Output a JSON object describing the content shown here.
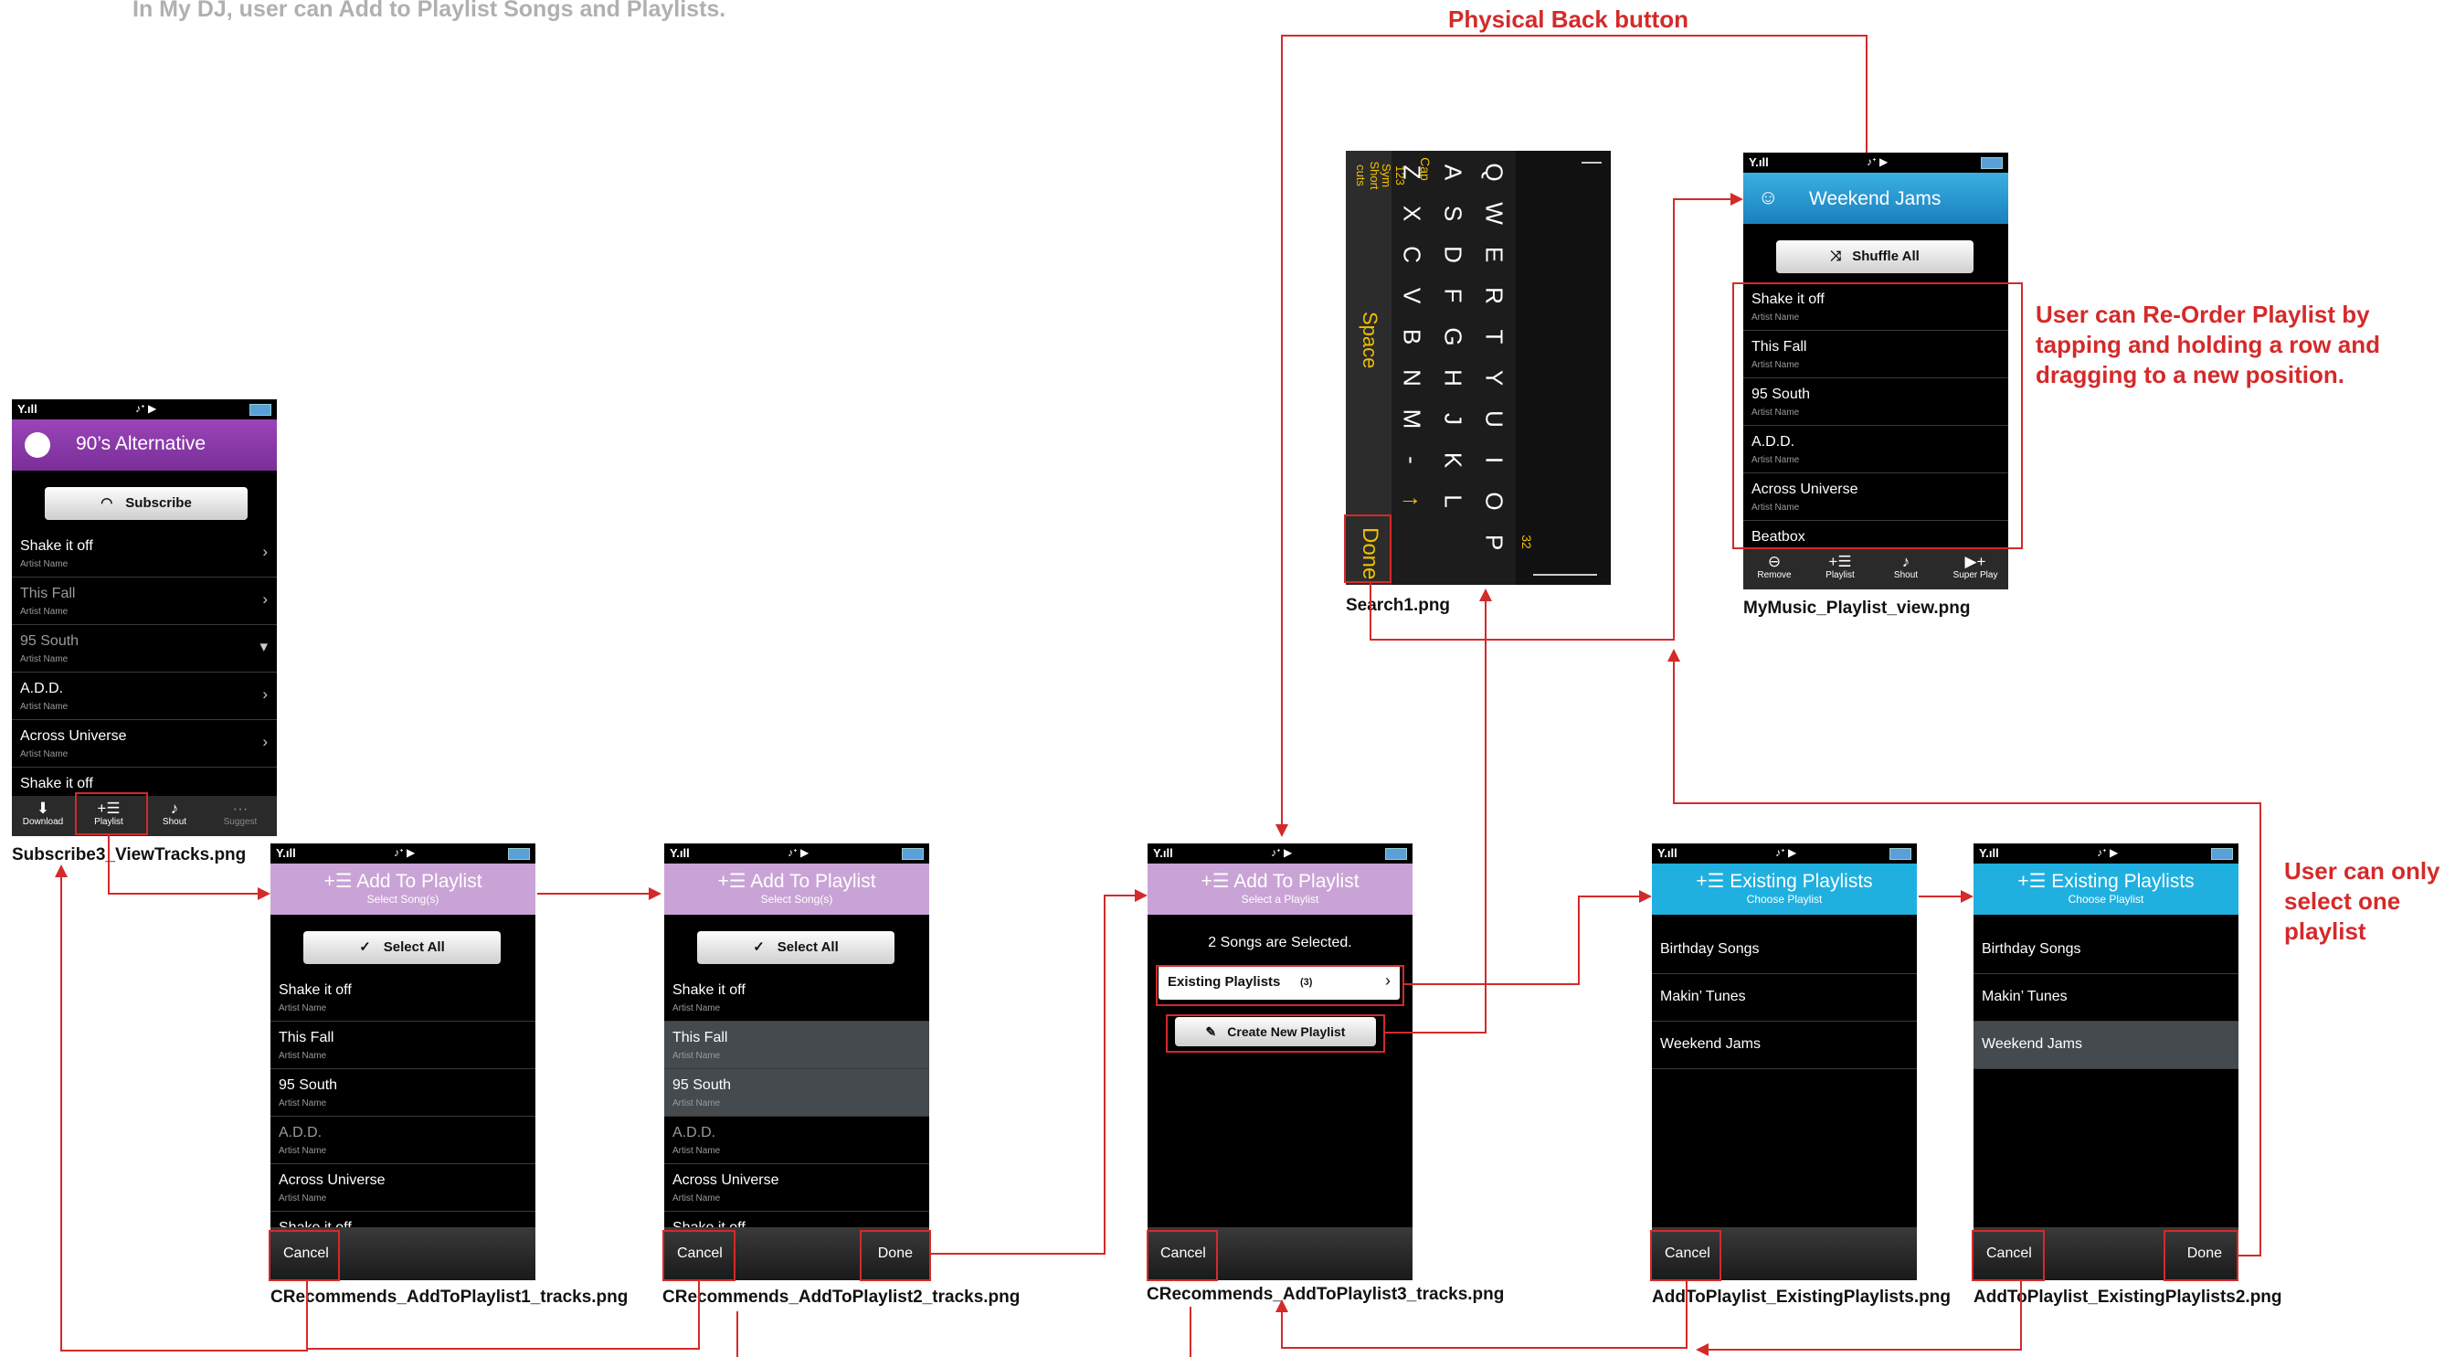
{
  "title": "In My DJ, user can Add to Playlist Songs and Playlists.",
  "notes": {
    "back": "Physical Back button",
    "reorder": [
      "User can Re-Order Playlist by",
      "tapping and holding a row and",
      "dragging to a new position."
    ],
    "only_one": [
      "User can only",
      "select one",
      "playlist"
    ]
  },
  "captions": {
    "s1": "Subscribe3_ViewTracks.png",
    "s2": "CRecommends_AddToPlaylist1_tracks.png",
    "s3": "CRecommends_AddToPlaylist2_tracks.png",
    "s4": "CRecommends_AddToPlaylist3_tracks.png",
    "s5": "AddToPlaylist_ExistingPlaylists.png",
    "s6": "AddToPlaylist_ExistingPlaylists2.png",
    "search": "Search1.png",
    "mymusic": "MyMusic_Playlist_view.png"
  },
  "colors": {
    "accent": "#d42a2a",
    "purple": "#8a3aa8",
    "lilac": "#c9a3d6",
    "cyan": "#1fb0e0",
    "blue": "#2a8fd0"
  },
  "artist": "Artist Name",
  "s1": {
    "header": "90’s Alternative",
    "button": "Subscribe",
    "tracks": [
      "Shake it off",
      "This Fall",
      "95 South",
      "A.D.D.",
      "Across Universe",
      "Shake it off"
    ],
    "tabs": [
      "Download",
      "Playlist",
      "Shout",
      "Suggest"
    ]
  },
  "add": {
    "title": "Add To Playlist",
    "sub_songs": "Select Song(s)",
    "sub_playlist": "Select a Playlist",
    "select_all": "Select All",
    "tracks": [
      "Shake it off",
      "This Fall",
      "95 South",
      "A.D.D.",
      "Across Universe",
      "Shake it off"
    ],
    "cancel": "Cancel",
    "done": "Done",
    "selected_msg": "2 Songs are Selected.",
    "existing": "Existing Playlists",
    "existing_count": "(3)",
    "create_new": "Create New Playlist"
  },
  "existing": {
    "title": "Existing Playlists",
    "sub": "Choose Playlist",
    "items": [
      "Birthday Songs",
      "Makin’ Tunes",
      "Weekend Jams"
    ]
  },
  "mymusic": {
    "header": "Weekend Jams",
    "button": "Shuffle All",
    "tracks": [
      "Shake it off",
      "This Fall",
      "95 South",
      "A.D.D.",
      "Across Universe",
      "Beatbox"
    ],
    "tabs": [
      "Remove",
      "Playlist",
      "Shout",
      "Super Play"
    ]
  },
  "keyboard": {
    "rows": [
      [
        "Q",
        "W",
        "E",
        "R",
        "T",
        "Y",
        "U",
        "I",
        "O",
        "P"
      ],
      [
        "A",
        "S",
        "D",
        "F",
        "G",
        "H",
        "J",
        "K",
        "L"
      ],
      [
        "Z",
        "X",
        "C",
        "V",
        "B",
        "N",
        "M",
        "-",
        "↑"
      ]
    ],
    "left": [
      "Short cuts",
      "123 Sym",
      "Cap"
    ],
    "space": "Space",
    "done": "Done",
    "count": "32"
  }
}
